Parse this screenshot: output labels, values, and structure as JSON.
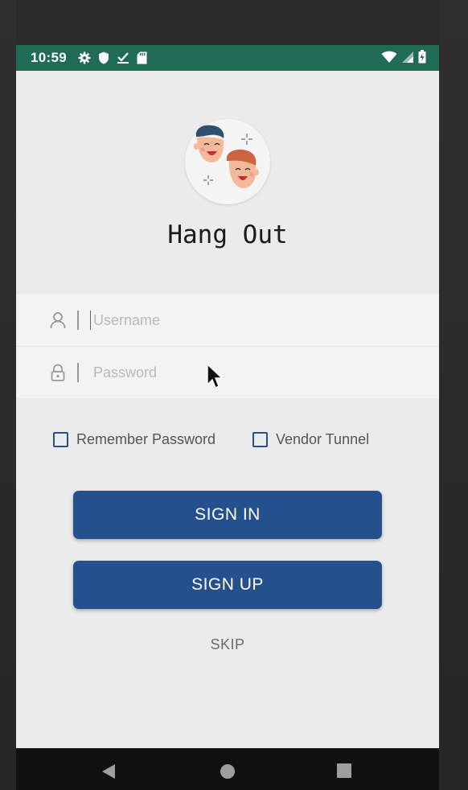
{
  "status_bar": {
    "time": "10:59",
    "left_icons": [
      "gear-icon",
      "shield-icon",
      "download-done-icon",
      "sd-card-icon"
    ],
    "right_icons": [
      "wifi-icon",
      "signal-icon",
      "battery-icon"
    ],
    "color": "#1f6b55"
  },
  "app": {
    "logo": "two-friends-logo",
    "title": "Hang Out"
  },
  "login": {
    "username_placeholder": "Username",
    "password_placeholder": "Password",
    "remember_label": "Remember Password",
    "vendor_label": "Vendor Tunnel",
    "signin_label": "SIGN IN",
    "signup_label": "SIGN UP",
    "skip_label": "SKIP"
  },
  "colors": {
    "accent": "#24508e",
    "background": "#ebebeb"
  },
  "nav_bar": {
    "buttons": [
      "back-icon",
      "home-icon",
      "recent-apps-icon"
    ]
  }
}
